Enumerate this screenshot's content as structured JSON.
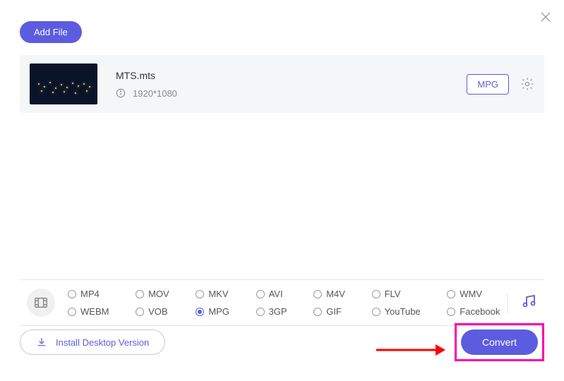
{
  "header": {
    "add_file_label": "Add File"
  },
  "file": {
    "name": "MTS.mts",
    "resolution": "1920*1080",
    "output_format": "MPG"
  },
  "formats": {
    "selected": "MPG",
    "options": [
      "MP4",
      "MOV",
      "MKV",
      "AVI",
      "M4V",
      "FLV",
      "WMV",
      "WEBM",
      "VOB",
      "MPG",
      "3GP",
      "GIF",
      "YouTube",
      "Facebook"
    ]
  },
  "footer": {
    "install_label": "Install Desktop Version",
    "convert_label": "Convert"
  }
}
